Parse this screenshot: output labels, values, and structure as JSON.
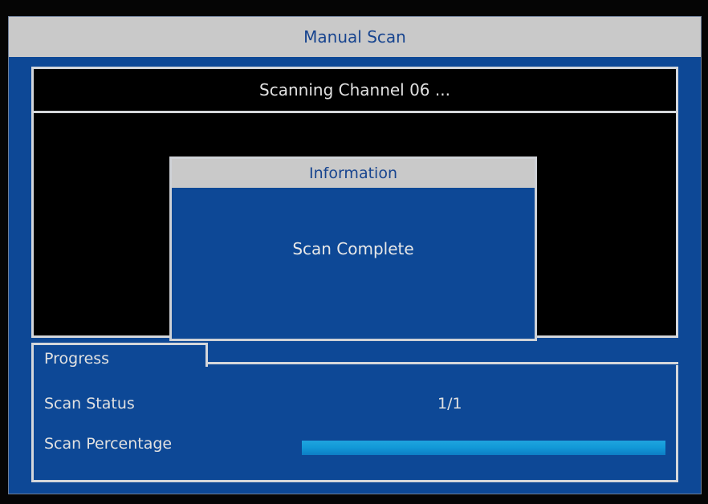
{
  "window": {
    "title": "Manual Scan"
  },
  "scan": {
    "status_message": "Scanning Channel 06 ..."
  },
  "dialog": {
    "title": "Information",
    "message": "Scan Complete"
  },
  "progress": {
    "tab_label": "Progress",
    "scan_status_label": "Scan Status",
    "scan_status_value": "1/1",
    "scan_percentage_label": "Scan Percentage",
    "scan_percentage_fraction": 1.0
  },
  "colors": {
    "background": "#050505",
    "panel_blue": "#0d4896",
    "title_bar_gray": "#c9c9c9",
    "title_text_blue": "#17448f",
    "progress_cyan": "#129ad8"
  }
}
